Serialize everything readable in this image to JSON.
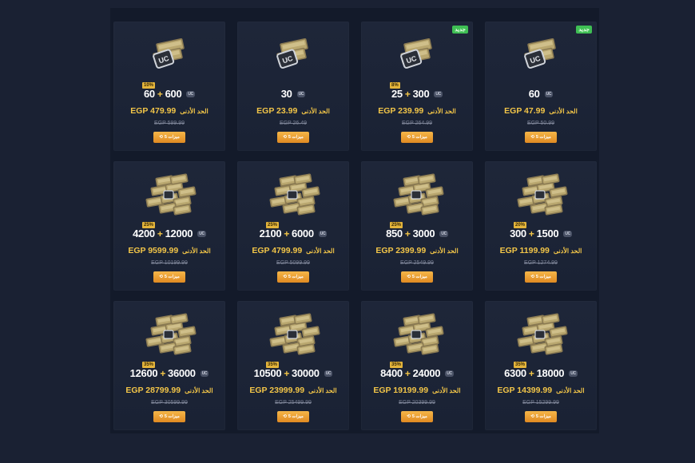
{
  "uc_chip": "UC",
  "min_label": "الحد الأدنى",
  "buy_label": "5 ميزات",
  "new_tag": "جديد",
  "cards": [
    {
      "base": "60",
      "bonus": "600",
      "bonus_tag": "10%",
      "price": "EGP 479.99",
      "old": "EGP 599.99",
      "new": false,
      "art": "small"
    },
    {
      "base": "30",
      "bonus": "",
      "bonus_tag": "",
      "price": "EGP 23.99",
      "old": "EGP 26.49",
      "new": false,
      "art": "small"
    },
    {
      "base": "25",
      "bonus": "300",
      "bonus_tag": "8%",
      "price": "EGP 239.99",
      "old": "EGP 264.99",
      "new": true,
      "art": "small"
    },
    {
      "base": "60",
      "bonus": "",
      "bonus_tag": "",
      "price": "EGP 47.99",
      "old": "EGP 50.99",
      "new": true,
      "art": "small"
    },
    {
      "base": "4200",
      "bonus": "12000",
      "bonus_tag": "25%",
      "price": "EGP 9599.99",
      "old": "EGP 10199.99",
      "new": false,
      "art": "large"
    },
    {
      "base": "2100",
      "bonus": "6000",
      "bonus_tag": "25%",
      "price": "EGP 4799.99",
      "old": "EGP 5099.99",
      "new": false,
      "art": "large"
    },
    {
      "base": "850",
      "bonus": "3000",
      "bonus_tag": "25%",
      "price": "EGP 2399.99",
      "old": "EGP 2549.99",
      "new": false,
      "art": "large"
    },
    {
      "base": "300",
      "bonus": "1500",
      "bonus_tag": "20%",
      "price": "EGP 1199.99",
      "old": "EGP 1274.99",
      "new": false,
      "art": "large"
    },
    {
      "base": "12600",
      "bonus": "36000",
      "bonus_tag": "35%",
      "price": "EGP 28799.99",
      "old": "EGP 30599.99",
      "new": false,
      "art": "large"
    },
    {
      "base": "10500",
      "bonus": "30000",
      "bonus_tag": "35%",
      "price": "EGP 23999.99",
      "old": "EGP 25499.99",
      "new": false,
      "art": "large"
    },
    {
      "base": "8400",
      "bonus": "24000",
      "bonus_tag": "35%",
      "price": "EGP 19199.99",
      "old": "EGP 20399.99",
      "new": false,
      "art": "large"
    },
    {
      "base": "6300",
      "bonus": "18000",
      "bonus_tag": "35%",
      "price": "EGP 14399.99",
      "old": "EGP 15299.99",
      "new": false,
      "art": "large"
    }
  ]
}
